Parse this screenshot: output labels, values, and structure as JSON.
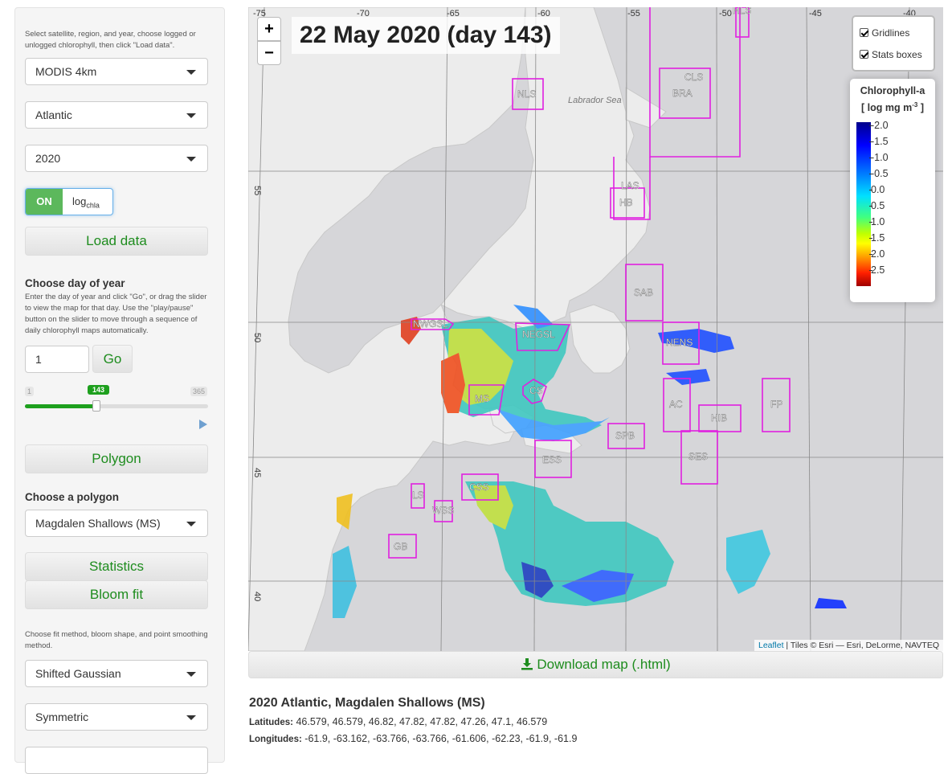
{
  "sidebar": {
    "intro_help": "Select satellite, region, and year, choose logged or unlogged chlorophyll, then click \"Load data\".",
    "satellite": "MODIS 4km",
    "region": "Atlantic",
    "year": "2020",
    "log_toggle_on": "ON",
    "log_label": "log",
    "log_sub": "chla",
    "load_button": "Load data",
    "day_heading": "Choose day of year",
    "day_help": "Enter the day of year and click \"Go\", or drag the slider to view the map for that day. Use the \"play/pause\" button on the slider to move through a sequence of daily chlorophyll maps automatically.",
    "day_value": "1",
    "go_button": "Go",
    "slider_min": "1",
    "slider_max": "365",
    "slider_value": "143",
    "slider_fraction": 0.39,
    "polygon_button": "Polygon",
    "polygon_heading": "Choose a polygon",
    "polygon_select": "Magdalen Shallows (MS)",
    "statistics_button": "Statistics",
    "bloomfit_button": "Bloom fit",
    "fit_help": "Choose fit method, bloom shape, and point smoothing method.",
    "fit_method": "Shifted Gaussian",
    "bloom_shape": "Symmetric"
  },
  "map": {
    "date_title": "22 May 2020 (day 143)",
    "zoom_in": "+",
    "zoom_out": "−",
    "layers": [
      "Gridlines",
      "Stats boxes"
    ],
    "legend_title_1": "Chlorophyll-a",
    "legend_title_2": "[ log mg m",
    "legend_title_sup": "-3",
    "legend_title_3": " ]",
    "legend_ticks": [
      "-2.0",
      "-1.5",
      "-1.0",
      "-0.5",
      "0.0",
      "0.5",
      "1.0",
      "1.5",
      "2.0",
      "2.5"
    ],
    "attribution_leaflet": "Leaflet",
    "attribution_rest": " | Tiles © Esri — Esri, DeLorme, NAVTEQ",
    "lon_labels": [
      "-75",
      "-70",
      "-65",
      "-60",
      "-55",
      "-50",
      "-45",
      "-40"
    ],
    "lat_labels": [
      "55",
      "50",
      "45",
      "40"
    ],
    "sea_label": "Labrador Sea",
    "box_labels": [
      "NLS",
      "CLS",
      "BRA",
      "LAS",
      "HB",
      "SAB",
      "NWGSL",
      "NEGSL",
      "NENS",
      "MS",
      "CS",
      "AC",
      "FP",
      "HIB",
      "SPB",
      "ESS",
      "SES",
      "CSS",
      "LS",
      "WSS",
      "GB",
      "HLS"
    ],
    "colors": {
      "box": "#e020e0",
      "land": "#ececec",
      "water": "#d6d6d9"
    }
  },
  "download_button": "Download map (.html)",
  "summary": {
    "title": "2020 Atlantic, Magdalen Shallows (MS)",
    "lat_label": "Latitudes:",
    "lat_values": "46.579, 46.579, 46.82, 47.82, 47.82, 47.26, 47.1, 46.579",
    "lon_label": "Longitudes:",
    "lon_values": "-61.9, -63.162, -63.766, -63.766, -61.606, -62.23, -61.9, -61.9"
  }
}
